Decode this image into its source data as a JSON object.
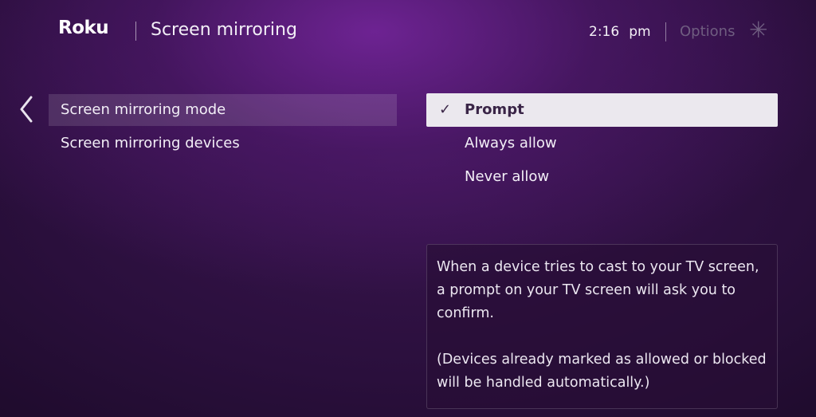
{
  "header": {
    "logo": "Roku",
    "title": "Screen mirroring",
    "time": "2:16",
    "ampm": "pm",
    "options_label": "Options",
    "options_icon": "asterisk-icon"
  },
  "nav": {
    "back_icon": "chevron-left-icon"
  },
  "menu": {
    "items": [
      {
        "label": "Screen mirroring mode",
        "focused": true
      },
      {
        "label": "Screen mirroring devices",
        "focused": false
      }
    ]
  },
  "mode_options": {
    "selected_index": 0,
    "items": [
      {
        "label": "Prompt",
        "check": "✓"
      },
      {
        "label": "Always allow"
      },
      {
        "label": "Never allow"
      }
    ]
  },
  "info": {
    "paragraph1": "When a device tries to cast to your TV screen, a prompt on your TV screen will ask you to confirm.",
    "paragraph2": "(Devices already marked as allowed or blocked will be handled automatically.)"
  }
}
